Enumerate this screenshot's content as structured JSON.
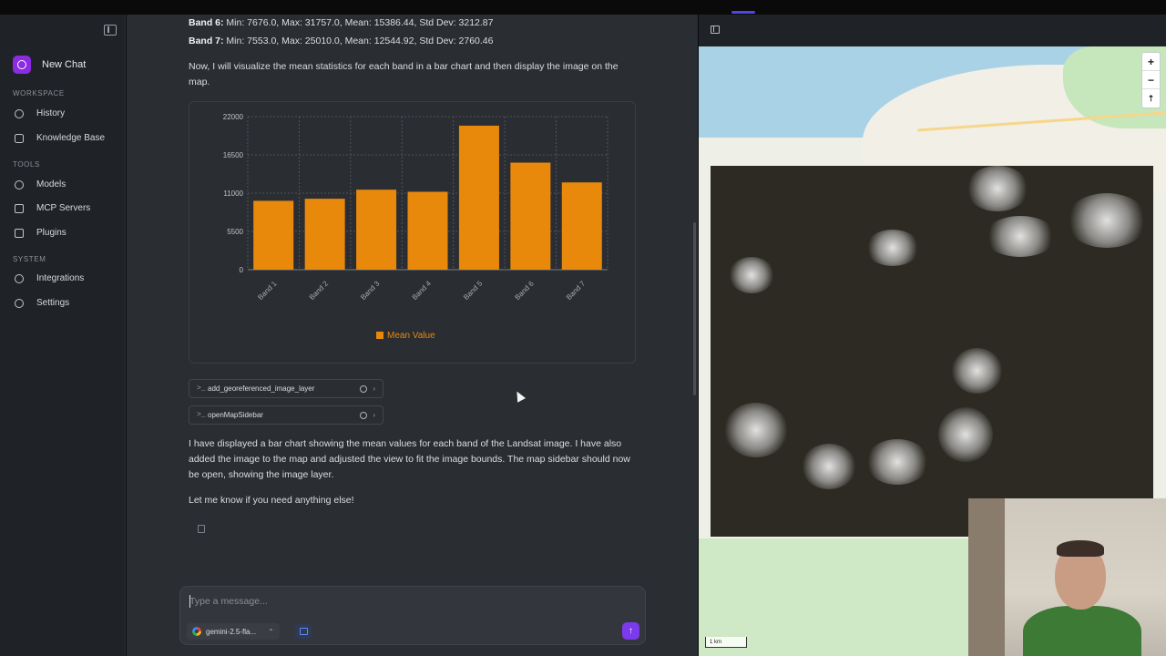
{
  "sidebar": {
    "new_chat": "New Chat",
    "sections": {
      "workspace": "WORKSPACE",
      "tools": "TOOLS",
      "system": "SYSTEM"
    },
    "items": {
      "history": "History",
      "knowledge_base": "Knowledge Base",
      "models": "Models",
      "mcp_servers": "MCP Servers",
      "plugins": "Plugins",
      "integrations": "Integrations",
      "settings": "Settings"
    }
  },
  "chat": {
    "band6_label": "Band 6:",
    "band6_stats": " Min: 7676.0, Max: 31757.0, Mean: 15386.44, Std Dev: 3212.87",
    "band7_label": "Band 7:",
    "band7_stats": " Min: 7553.0, Max: 25010.0, Mean: 12544.92, Std Dev: 2760.46",
    "intro": "Now, I will visualize the mean statistics for each band in a bar chart and then display the image on the map.",
    "tool_calls": [
      {
        "prefix": ">_",
        "name": "add_georeferenced_image_layer"
      },
      {
        "prefix": ">_",
        "name": "openMapSidebar"
      }
    ],
    "summary": "I have displayed a bar chart showing the mean values for each band of the Landsat image. I have also added the image to the map and adjusted the view to fit the image bounds. The map sidebar should now be open, showing the image layer.",
    "closing": "Let me know if you need anything else!"
  },
  "composer": {
    "placeholder": "Type a message...",
    "model": "gemini-2.5-fla...",
    "send_icon": "arrow-up-icon"
  },
  "map": {
    "zoom_in": "+",
    "zoom_out": "−",
    "reset": "⇡",
    "scale": "1 km"
  },
  "chart_data": {
    "type": "bar",
    "categories": [
      "Band 1",
      "Band 2",
      "Band 3",
      "Band 4",
      "Band 5",
      "Band 6",
      "Band 7"
    ],
    "series": [
      {
        "name": "Mean Value",
        "values": [
          9900,
          10200,
          11500,
          11200,
          20700,
          15386.44,
          12544.92
        ],
        "color": "#e8890c"
      }
    ],
    "ylim": [
      0,
      22000
    ],
    "yticks": [
      "0",
      "5500",
      "11000",
      "16500",
      "22000"
    ],
    "grid": true,
    "legend": "bottom"
  }
}
